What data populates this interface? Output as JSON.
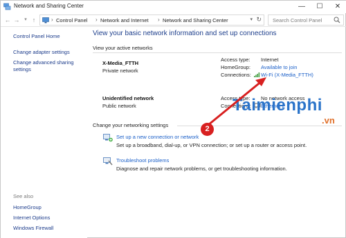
{
  "window": {
    "title": "Network and Sharing Center",
    "controls": {
      "minimize": "—",
      "maximize": "☐",
      "close": "✕"
    }
  },
  "address_bar": {
    "crumbs": [
      "Control Panel",
      "Network and Internet",
      "Network and Sharing Center"
    ],
    "search_placeholder": "Search Control Panel"
  },
  "sidebar": {
    "items": [
      {
        "label": "Control Panel Home"
      },
      {
        "label": "Change adapter settings"
      },
      {
        "label": "Change advanced sharing"
      },
      {
        "label": "settings"
      }
    ],
    "see_also_label": "See also",
    "see_also": [
      {
        "label": "HomeGroup"
      },
      {
        "label": "Internet Options"
      },
      {
        "label": "Windows Firewall"
      }
    ]
  },
  "main": {
    "title": "View your basic network information and set up connections",
    "active_networks_heading": "View your active networks",
    "networks": [
      {
        "name": "X-Media_FTTH",
        "type": "Private network",
        "access_type_label": "Access type:",
        "access_type": "Internet",
        "homegroup_label": "HomeGroup:",
        "homegroup": "Available to join",
        "connections_label": "Connections:",
        "connection": "Wi-Fi (X-Media_FTTH)"
      },
      {
        "name": "Unidentified network",
        "type": "Public network",
        "access_type_label": "Access type:",
        "access_type": "No network access",
        "connections_label": "Connections:",
        "connection": "Ethernet 2"
      }
    ],
    "change_settings_heading": "Change your networking settings",
    "tasks": [
      {
        "link": "Set up a new connection or network",
        "desc": "Set up a broadband, dial-up, or VPN connection; or set up a router or access point."
      },
      {
        "link": "Troubleshoot problems",
        "desc": "Diagnose and repair network problems, or get troubleshooting information."
      }
    ]
  },
  "annotation": {
    "step": "2",
    "color": "#d82020"
  },
  "watermark": {
    "text": "Taimienphi",
    "suffix": ".vn"
  }
}
